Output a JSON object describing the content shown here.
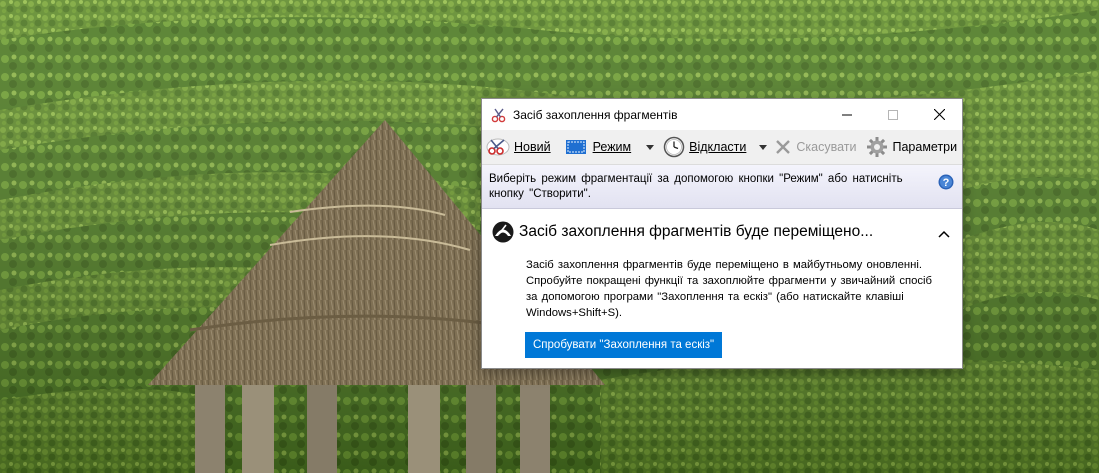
{
  "window": {
    "title": "Засіб захоплення фрагментів",
    "minimize_label": "–",
    "maximize_label": "☐",
    "close_label": "✕"
  },
  "toolbar": {
    "new_label": "Новий",
    "mode_label": "Режим",
    "delay_label": "Відкласти",
    "cancel_label": "Скасувати",
    "options_label": "Параметри"
  },
  "infobar": {
    "message": "Виберіть режим фрагментації за допомогою кнопки \"Режим\" або натисніть кнопку \"Створити\"."
  },
  "notice": {
    "title": "Засіб захоплення фрагментів буде переміщено...",
    "body": "Засіб захоплення фрагментів буде переміщено в майбутньому оновленні. Спробуйте покращені функції та захоплюйте фрагменти у звичайний спосіб за допомогою програми \"Захоплення та ескіз\" (або натискайте клавіші Windows+Shift+S).",
    "button_label": "Спробувати \"Захоплення та ескіз\""
  },
  "colors": {
    "accent": "#0078d7",
    "hedge_green": "#5f8a2a",
    "thatch": "#8a7a5c"
  }
}
